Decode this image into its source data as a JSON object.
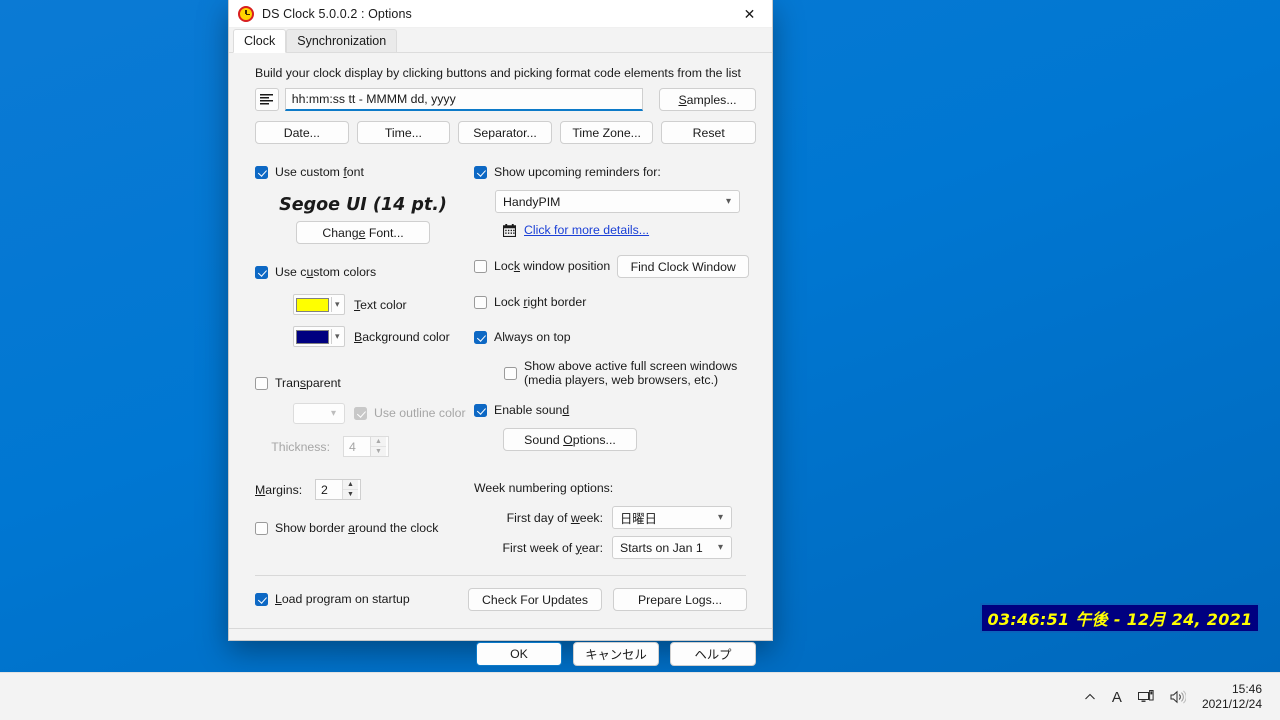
{
  "window": {
    "title": "DS Clock 5.0.0.2 : Options",
    "app_icon": "clock-icon",
    "close_label": "✕"
  },
  "tabs": [
    {
      "label": "Clock",
      "selected": true
    },
    {
      "label": "Synchronization",
      "selected": false
    }
  ],
  "clock_tab": {
    "hint": "Build your clock display by clicking buttons and picking format code elements from the list",
    "format_input": {
      "value": "hh:mm:ss tt - MMMM dd, yyyy",
      "list_icon": "format-list-icon"
    },
    "samples_button": "Samples...",
    "format_buttons": [
      "Date...",
      "Time...",
      "Separator...",
      "Time Zone...",
      "Reset"
    ],
    "use_custom_font": {
      "label": "Use custom font",
      "checked": true
    },
    "font_preview": "Segoe UI (14 pt.)",
    "change_font_button": "Change Font...",
    "use_custom_colors": {
      "label": "Use custom colors",
      "checked": true
    },
    "text_color": {
      "label": "Text color",
      "value": "#FFFF00"
    },
    "background_color": {
      "label": "Background color",
      "value": "#000080"
    },
    "transparent": {
      "label": "Transparent",
      "checked": false
    },
    "outline_color": {
      "label": "Use outline color",
      "checked": true,
      "disabled": true,
      "value": ""
    },
    "thickness": {
      "label": "Thickness:",
      "value": "4",
      "disabled": true
    },
    "margins": {
      "label": "Margins:",
      "value": "2"
    },
    "show_border": {
      "label": "Show border around the clock",
      "checked": false
    },
    "show_reminders": {
      "label": "Show upcoming reminders for:",
      "checked": true
    },
    "reminders_source": {
      "value": "HandyPIM"
    },
    "more_details_link": {
      "label": "Click for more details...",
      "icon": "calendar-icon"
    },
    "lock_window_position": {
      "label": "Lock window position",
      "checked": false
    },
    "find_clock_window_button": "Find Clock Window",
    "lock_right_border": {
      "label": "Lock right border",
      "checked": false
    },
    "always_on_top": {
      "label": "Always on top",
      "checked": true
    },
    "show_above_fullscreen": {
      "line1": "Show above active full screen windows",
      "line2": "(media players, web browsers, etc.)",
      "checked": false
    },
    "enable_sound": {
      "label": "Enable sound",
      "checked": true
    },
    "sound_options_button": "Sound Options...",
    "week_numbering_title": "Week numbering options:",
    "first_day_of_week": {
      "label": "First day of week:",
      "value": "日曜日"
    },
    "first_week_of_year": {
      "label": "First week of year:",
      "value": "Starts on Jan 1"
    },
    "load_on_startup": {
      "label": "Load program on startup",
      "checked": true
    },
    "check_updates_button": "Check For Updates",
    "prepare_logs_button": "Prepare Logs..."
  },
  "footer": {
    "ok_button": "OK",
    "cancel_button": "キャンセル",
    "help_button": "ヘルプ"
  },
  "clock_widget": {
    "text": "03:46:51 午後 - 12月 24, 2021",
    "text_color": "#FFFF00",
    "background_color": "#000080"
  },
  "taskbar": {
    "show_hidden_icons": "show-hidden-icons-icon",
    "ime_indicator": "A",
    "network_icon": "network-icon",
    "volume_icon": "volume-icon",
    "time": "15:46",
    "date": "2021/12/24"
  }
}
